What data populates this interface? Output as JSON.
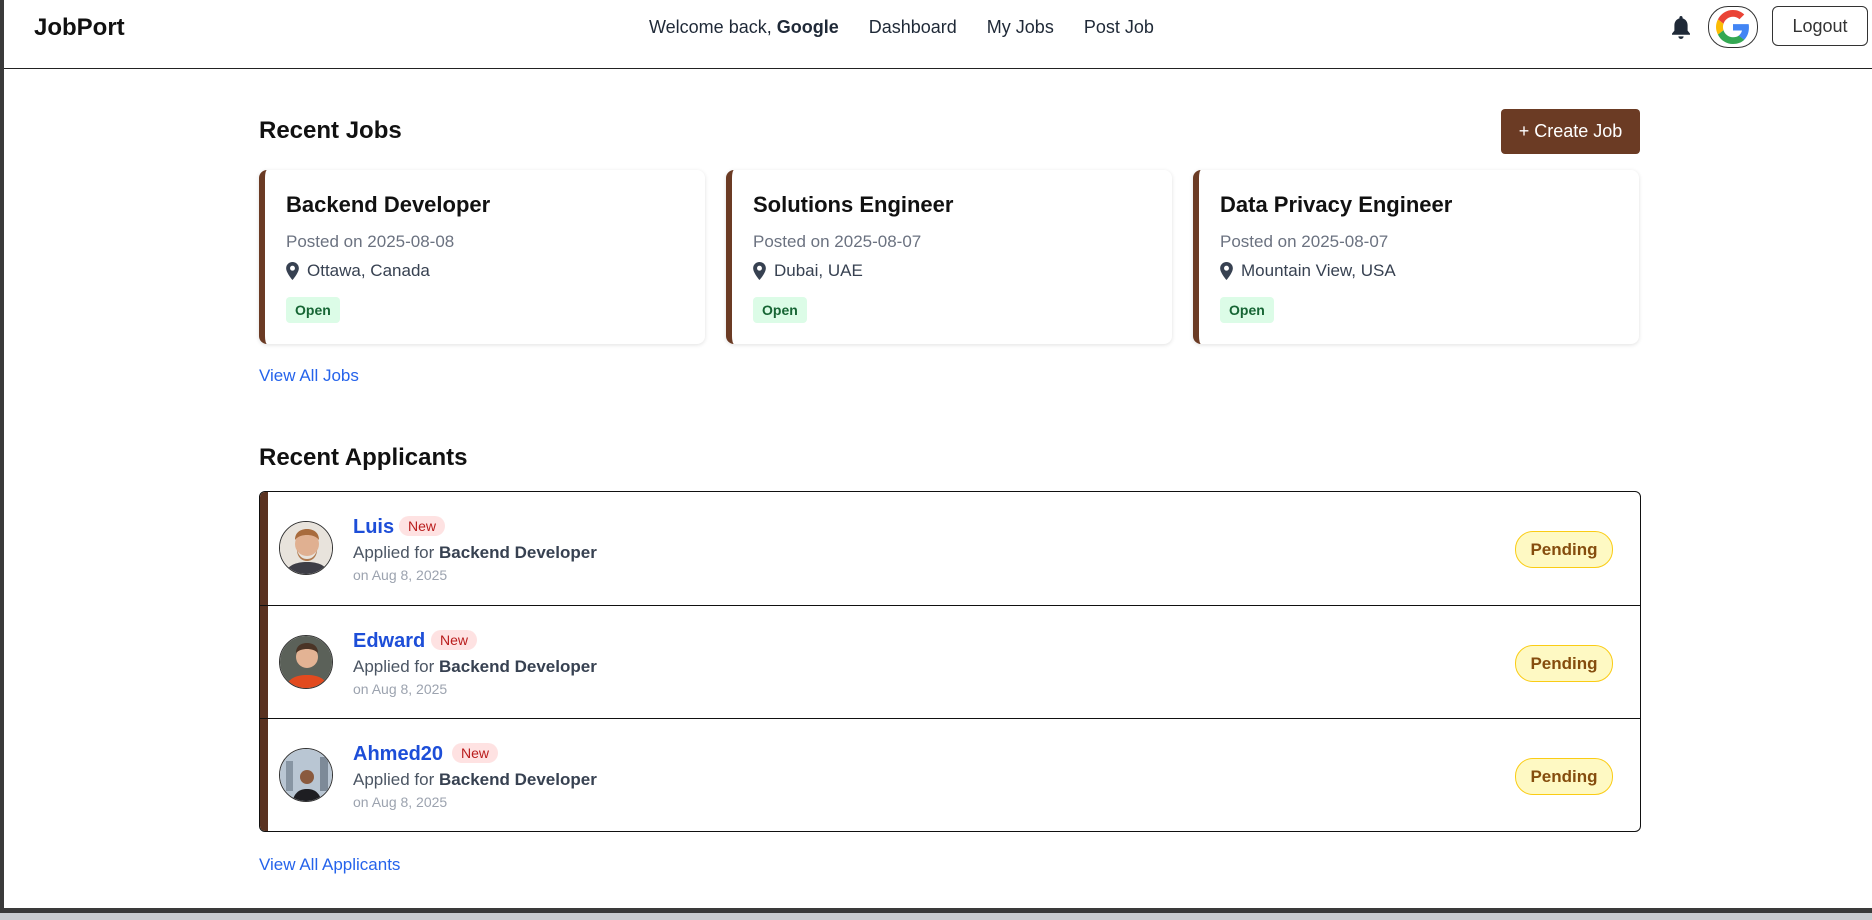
{
  "navbar": {
    "brand": "JobPort",
    "welcome_prefix": "Welcome back,",
    "welcome_name": "Google",
    "links": [
      "Dashboard",
      "My Jobs",
      "Post Job"
    ],
    "logout_label": "Logout"
  },
  "jobs_section": {
    "title": "Recent Jobs",
    "create_label": "+ Create Job",
    "view_all_label": "View All Jobs",
    "jobs": [
      {
        "title": "Backend Developer",
        "posted": "Posted on 2025-08-08",
        "location": "Ottawa, Canada",
        "status": "Open"
      },
      {
        "title": "Solutions Engineer",
        "posted": "Posted on 2025-08-07",
        "location": "Dubai, UAE",
        "status": "Open"
      },
      {
        "title": "Data Privacy Engineer",
        "posted": "Posted on 2025-08-07",
        "location": "Mountain View, USA",
        "status": "Open"
      }
    ]
  },
  "applicants_section": {
    "title": "Recent Applicants",
    "view_all_label": "View All Applicants",
    "applied_prefix": "Applied for",
    "applicants": [
      {
        "name": "Luis",
        "badge": "New",
        "job": "Backend Developer",
        "date": "on Aug 8, 2025",
        "status": "Pending"
      },
      {
        "name": "Edward",
        "badge": "New",
        "job": "Backend Developer",
        "date": "on Aug 8, 2025",
        "status": "Pending"
      },
      {
        "name": "Ahmed20",
        "badge": "New",
        "job": "Backend Developer",
        "date": "on Aug 8, 2025",
        "status": "Pending"
      }
    ]
  },
  "colors": {
    "brand_brown": "#6b3b24",
    "link_blue": "#2563eb",
    "open_green": "#166534",
    "pending_yellow": "#fef9c3",
    "new_red": "#b91c1c"
  },
  "icons": [
    "bell-icon",
    "google-avatar-icon",
    "location-pin-icon"
  ]
}
